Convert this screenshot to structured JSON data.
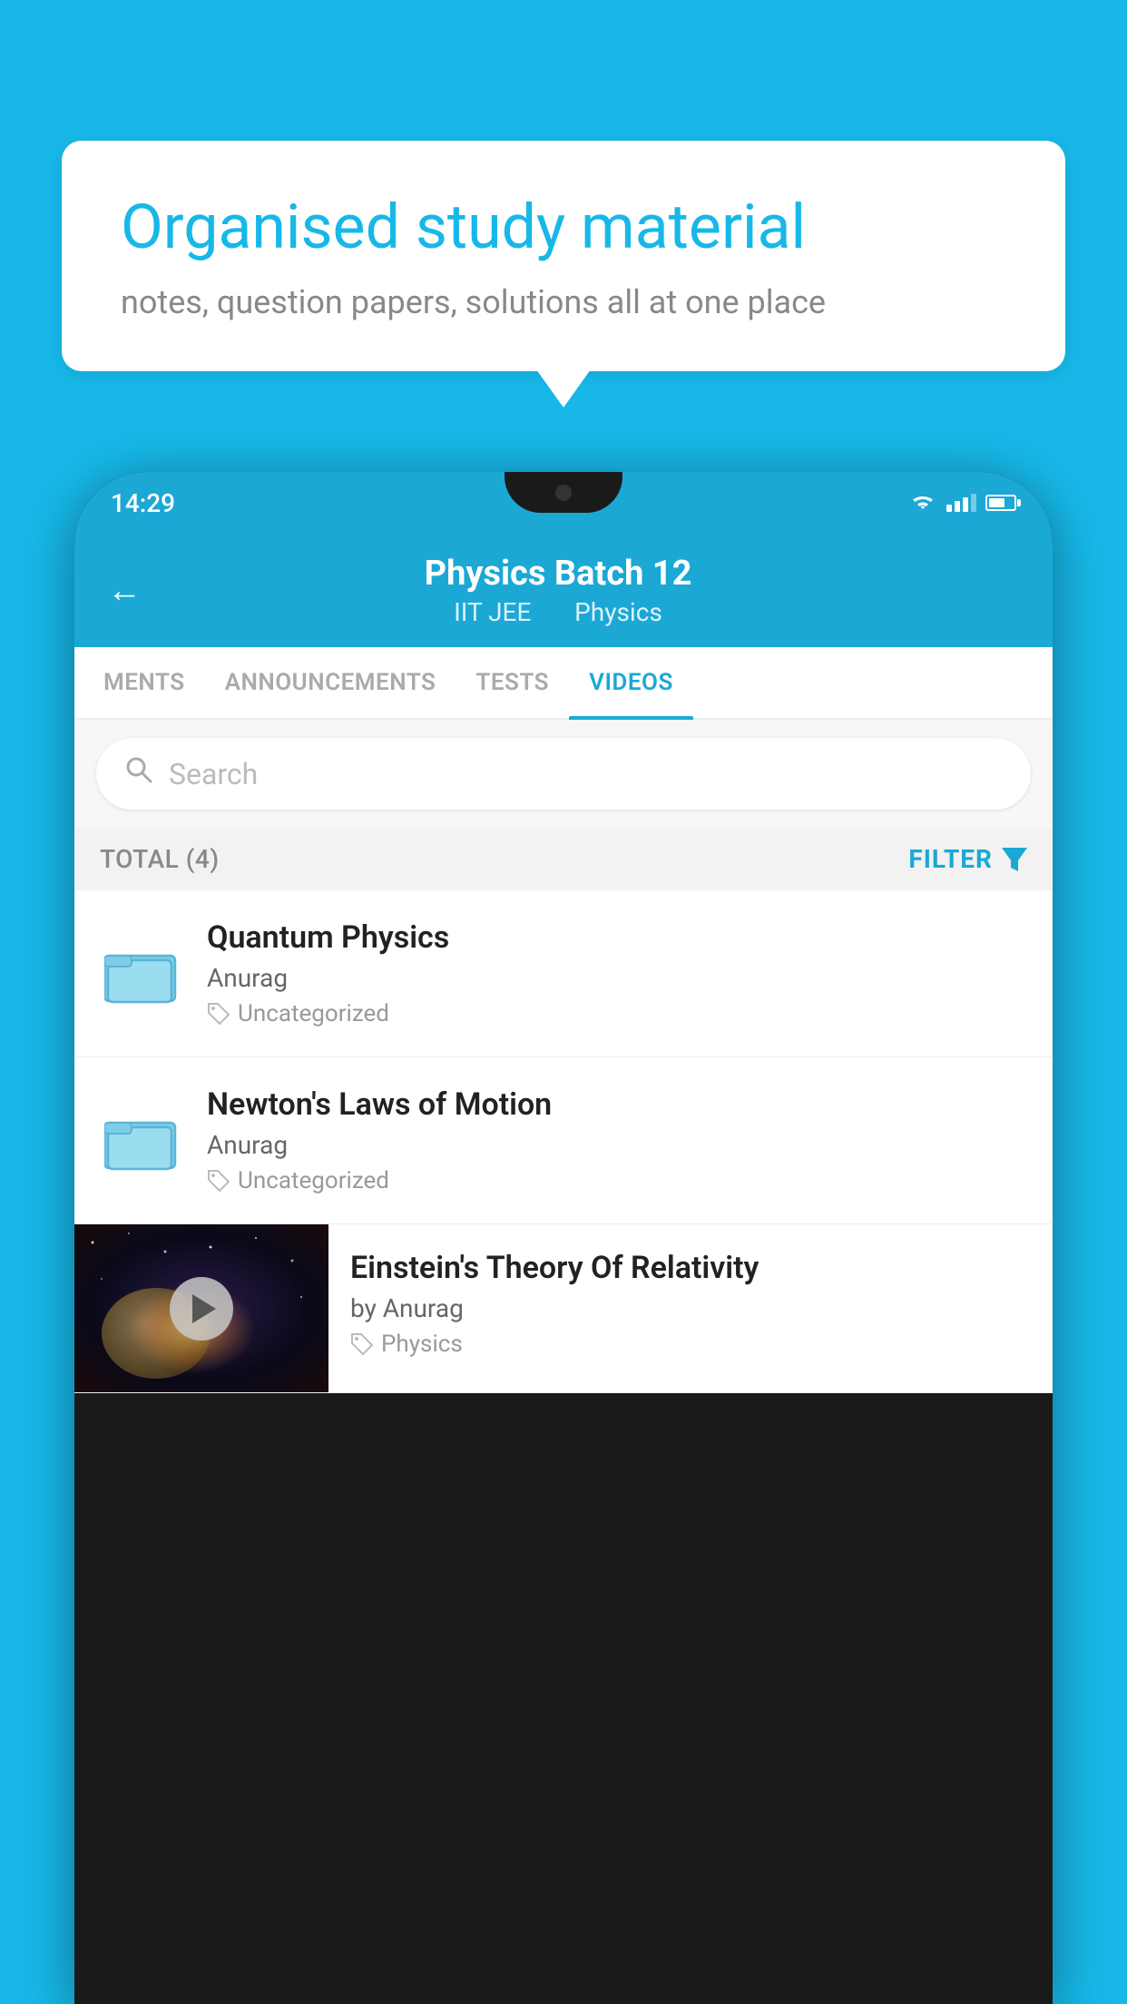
{
  "background_color": "#17b8e8",
  "speech_bubble": {
    "title": "Organised study material",
    "subtitle": "notes, question papers, solutions all at one place"
  },
  "phone": {
    "status_bar": {
      "time": "14:29"
    },
    "header": {
      "title": "Physics Batch 12",
      "subtitle_part1": "IIT JEE",
      "subtitle_part2": "Physics",
      "back_label": "←"
    },
    "tabs": [
      {
        "label": "MENTS",
        "active": false
      },
      {
        "label": "ANNOUNCEMENTS",
        "active": false
      },
      {
        "label": "TESTS",
        "active": false
      },
      {
        "label": "VIDEOS",
        "active": true
      }
    ],
    "search": {
      "placeholder": "Search"
    },
    "filter_bar": {
      "total_label": "TOTAL (4)",
      "filter_label": "FILTER"
    },
    "videos": [
      {
        "title": "Quantum Physics",
        "author": "Anurag",
        "tag": "Uncategorized",
        "type": "folder"
      },
      {
        "title": "Newton's Laws of Motion",
        "author": "Anurag",
        "tag": "Uncategorized",
        "type": "folder"
      },
      {
        "title": "Einstein's Theory Of Relativity",
        "author": "by Anurag",
        "tag": "Physics",
        "type": "thumbnail"
      }
    ]
  }
}
